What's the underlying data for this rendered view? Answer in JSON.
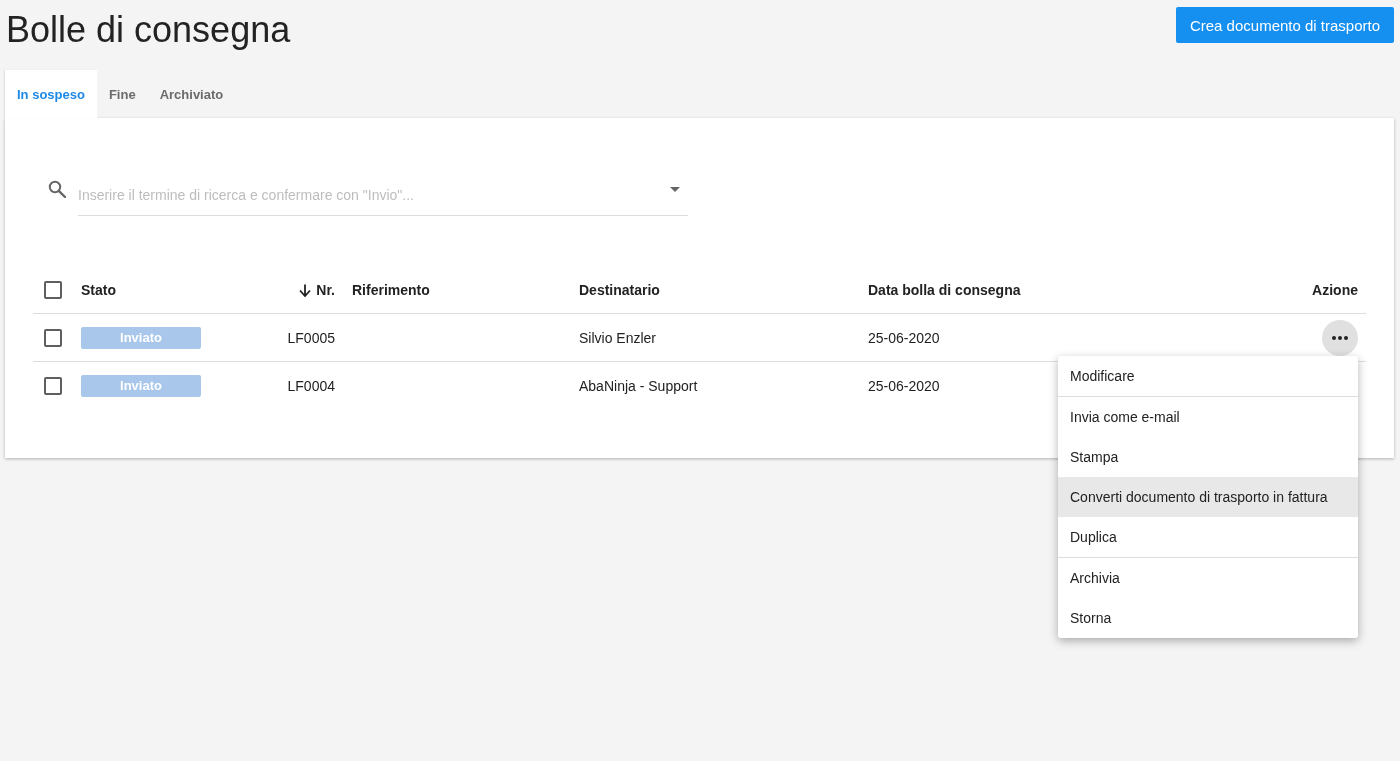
{
  "page": {
    "title": "Bolle di consegna",
    "primary_button": "Crea documento di trasporto"
  },
  "tabs": [
    {
      "label": "In sospeso",
      "selected": true
    },
    {
      "label": "Fine",
      "selected": false
    },
    {
      "label": "Archiviato",
      "selected": false
    }
  ],
  "search": {
    "placeholder": "Inserire il termine di ricerca e confermare con \"Invio\"..."
  },
  "table": {
    "select_all": {
      "checked": false
    },
    "columns": [
      {
        "label": "Stato",
        "sorted": false
      },
      {
        "label": "Nr.",
        "sorted": true
      },
      {
        "label": "Riferimento",
        "sorted": false
      },
      {
        "label": "Destinatario",
        "sorted": false
      },
      {
        "label": "Data bolla di consegna",
        "sorted": false
      },
      {
        "label": "Azione",
        "sorted": false
      }
    ],
    "rows": [
      {
        "checked": false,
        "status": "Inviato",
        "number": "LF0005",
        "recipient": "Silvio Enzler",
        "date": "25-06-2020",
        "action_menu": {
          "groups": [
            [
              {
                "label": "Modificare",
                "highlighted": false
              }
            ],
            [
              {
                "label": "Invia come e-mail",
                "highlighted": false
              },
              {
                "label": "Stampa",
                "highlighted": false
              },
              {
                "label": "Converti documento di trasporto in fattura",
                "highlighted": true
              },
              {
                "label": "Duplica",
                "highlighted": false
              }
            ],
            [
              {
                "label": "Archivia",
                "highlighted": false
              },
              {
                "label": "Storna",
                "highlighted": false
              }
            ]
          ]
        }
      },
      {
        "checked": false,
        "status": "Inviato",
        "number": "LF0004",
        "recipient": "AbaNinja - Support",
        "date": "25-06-2020"
      }
    ]
  }
}
